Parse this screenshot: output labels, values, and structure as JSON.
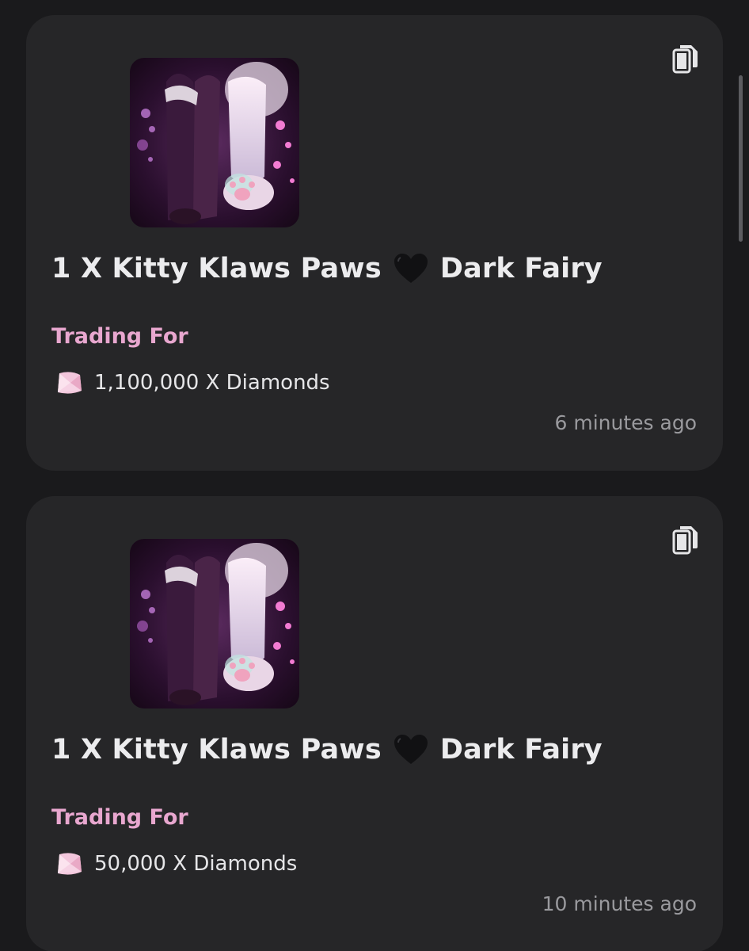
{
  "listings": [
    {
      "title_prefix": "1 X Kitty Klaws Paws",
      "title_emoji": "black-heart",
      "title_suffix": "Dark Fairy",
      "trading_label": "Trading For",
      "price": "1,100,000 X Diamonds",
      "time": "6 minutes ago"
    },
    {
      "title_prefix": "1 X Kitty Klaws Paws",
      "title_emoji": "black-heart",
      "title_suffix": "Dark Fairy",
      "trading_label": "Trading For",
      "price": "50,000 X Diamonds",
      "time": "10 minutes ago"
    }
  ],
  "colors": {
    "background": "#1a1a1c",
    "card": "#262628",
    "accent_pink": "#e8a7cf",
    "timestamp": "#9a9a9e"
  },
  "icons": [
    "copy-icon",
    "diamond-icon",
    "black-heart-icon"
  ]
}
